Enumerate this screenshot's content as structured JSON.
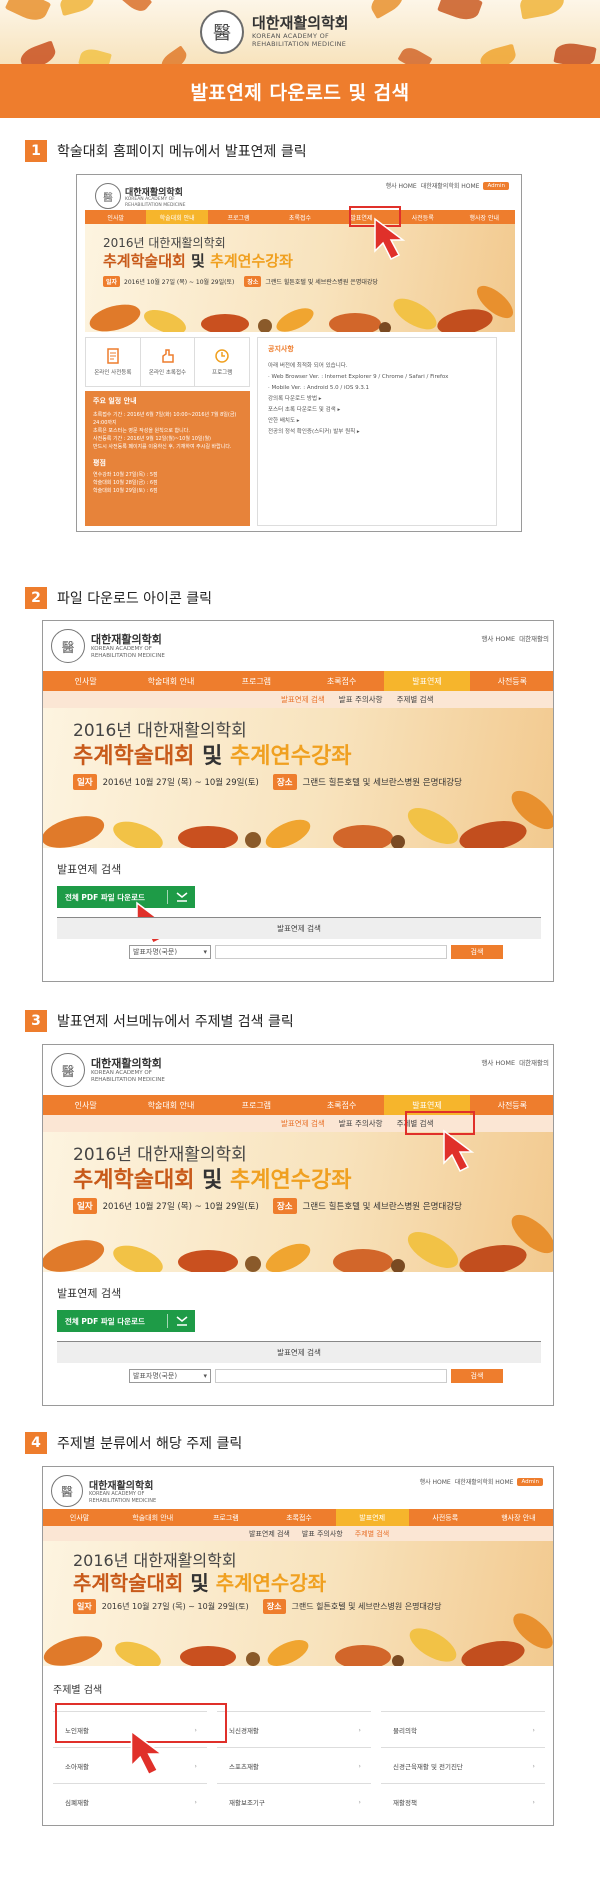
{
  "society": {
    "name_kr": "대한재활의학회",
    "name_en_1": "KOREAN ACADEMY OF",
    "name_en_2": "REHABILITATION MEDICINE",
    "seal_char": "醫"
  },
  "banner": {
    "title": "발표연제 다운로드 및 검색"
  },
  "steps": [
    {
      "num": "1",
      "text": "학술대회 홈페이지 메뉴에서 발표연제 클릭"
    },
    {
      "num": "2",
      "text": "파일 다운로드 아이콘 클릭"
    },
    {
      "num": "3",
      "text": "발표연제 서브메뉴에서 주제별 검색 클릭"
    },
    {
      "num": "4",
      "text": "주제별 분류에서 해당 주제 클릭"
    }
  ],
  "util": {
    "home": "행사 HOME",
    "society": "대한재활의학회 HOME",
    "society_short": "대한재활의",
    "admin": "Admin"
  },
  "nav": [
    "인사말",
    "학술대회 안내",
    "프로그램",
    "초록접수",
    "발표연제",
    "사전등록",
    "행사장 안내"
  ],
  "subnav": [
    "발표연제 검색",
    "발표 주의사항",
    "주제별 검색"
  ],
  "hero": {
    "year": "2016년 대한재활의학회",
    "main_a": "추계학술대회",
    "main_b": " 및 ",
    "main_c": "추계연수강좌",
    "date_tag": "일자",
    "date": "2016년 10월 27일 (목) ~ 10월 29일(토)",
    "place_tag": "장소",
    "place": "그랜드 힐튼호텔 및 세브란스병원 은명대강당"
  },
  "home": {
    "cards": [
      "온라인 사전등록",
      "온라인 초록접수",
      "프로그램"
    ],
    "schedule_title": "주요 일정 안내",
    "schedule_items": [
      "초록접수 기간 : 2016년 6월 7일(화) 10:00~2016년 7월 8일(금) 24:00까지",
      "초록은 포스터는 영문 작성을 원칙으로 합니다.",
      "사전등록 기간 : 2016년 9월 12일(월)~10월 10일(월)",
      "반드시 사전등록 페이지를 이용하신 후, 기재하여 주시길 바랍니다."
    ],
    "fee_title": "평점",
    "fee_items": [
      "연수강좌 10월 27일(목) : 5점",
      "학술대회 10월 28일(금) : 6점",
      "학술대회 10월 29일(토) : 6점"
    ],
    "notice_title": "공지사항",
    "notice_items": [
      "아래 버전에 최적화 되어 있습니다.",
      "· Web Browser Ver. : Internet Explorer 9 / Chrome / Safari / Firefox",
      "· Mobile Ver. : Android 5.0 / iOS 9.3.1",
      "강의록 다운로드 방법 ▸",
      "포스터 초록 다운로드 및 검색 ▸",
      "안한 배치도 ▸",
      "전공의 정석 확인증(스티커) 발부 원칙 ▸"
    ]
  },
  "search": {
    "title": "발표연제 검색",
    "download_btn": "전체 PDF 파일 다운로드",
    "table_head": "발표연제 검색",
    "select_value": "발표자명(국문)",
    "go": "검색"
  },
  "topics": {
    "title": "주제별 검색",
    "items": [
      "노인재활",
      "뇌신경재활",
      "물리의학",
      "소아재활",
      "스포츠재활",
      "신경근육재활 및 전기진단",
      "심폐재활",
      "재활보조기구",
      "재활정책"
    ]
  },
  "colors": {
    "accent": "#ee7d2d",
    "highlight": "#e0302a",
    "download": "#1e9b47",
    "active_nav": "#f6b52c"
  }
}
